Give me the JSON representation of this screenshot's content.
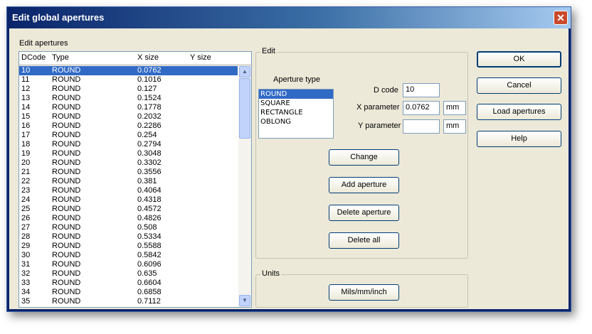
{
  "window": {
    "title": "Edit global apertures",
    "close_glyph": "✕"
  },
  "list": {
    "label": "Edit apertures",
    "columns": [
      "DCode",
      "Type",
      "X size",
      "Y size"
    ],
    "rows": [
      [
        "10",
        "ROUND",
        "0.0762",
        ""
      ],
      [
        "11",
        "ROUND",
        "0.1016",
        ""
      ],
      [
        "12",
        "ROUND",
        "0.127",
        ""
      ],
      [
        "13",
        "ROUND",
        "0.1524",
        ""
      ],
      [
        "14",
        "ROUND",
        "0.1778",
        ""
      ],
      [
        "15",
        "ROUND",
        "0.2032",
        ""
      ],
      [
        "16",
        "ROUND",
        "0.2286",
        ""
      ],
      [
        "17",
        "ROUND",
        "0.254",
        ""
      ],
      [
        "18",
        "ROUND",
        "0.2794",
        ""
      ],
      [
        "19",
        "ROUND",
        "0.3048",
        ""
      ],
      [
        "20",
        "ROUND",
        "0.3302",
        ""
      ],
      [
        "21",
        "ROUND",
        "0.3556",
        ""
      ],
      [
        "22",
        "ROUND",
        "0.381",
        ""
      ],
      [
        "23",
        "ROUND",
        "0.4064",
        ""
      ],
      [
        "24",
        "ROUND",
        "0.4318",
        ""
      ],
      [
        "25",
        "ROUND",
        "0.4572",
        ""
      ],
      [
        "26",
        "ROUND",
        "0.4826",
        ""
      ],
      [
        "27",
        "ROUND",
        "0.508",
        ""
      ],
      [
        "28",
        "ROUND",
        "0.5334",
        ""
      ],
      [
        "29",
        "ROUND",
        "0.5588",
        ""
      ],
      [
        "30",
        "ROUND",
        "0.5842",
        ""
      ],
      [
        "31",
        "ROUND",
        "0.6096",
        ""
      ],
      [
        "32",
        "ROUND",
        "0.635",
        ""
      ],
      [
        "33",
        "ROUND",
        "0.6604",
        ""
      ],
      [
        "34",
        "ROUND",
        "0.6858",
        ""
      ],
      [
        "35",
        "ROUND",
        "0.7112",
        ""
      ]
    ],
    "selected_index": 0
  },
  "edit": {
    "group_label": "Edit",
    "aperture_type_label": "Aperture type",
    "types": [
      "ROUND",
      "SQUARE",
      "RECTANGLE",
      "OBLONG"
    ],
    "selected_type": 0,
    "dcode_label": "D code",
    "dcode_value": "10",
    "x_label": "X parameter",
    "x_value": "0.0762",
    "x_unit": "mm",
    "y_label": "Y parameter",
    "y_value": "",
    "y_unit": "mm",
    "buttons": {
      "change": "Change",
      "add": "Add aperture",
      "delete": "Delete aperture",
      "delete_all": "Delete all"
    }
  },
  "units": {
    "group_label": "Units",
    "button": "Mils/mm/inch"
  },
  "side_buttons": {
    "ok": "OK",
    "cancel": "Cancel",
    "load": "Load apertures",
    "help": "Help"
  }
}
